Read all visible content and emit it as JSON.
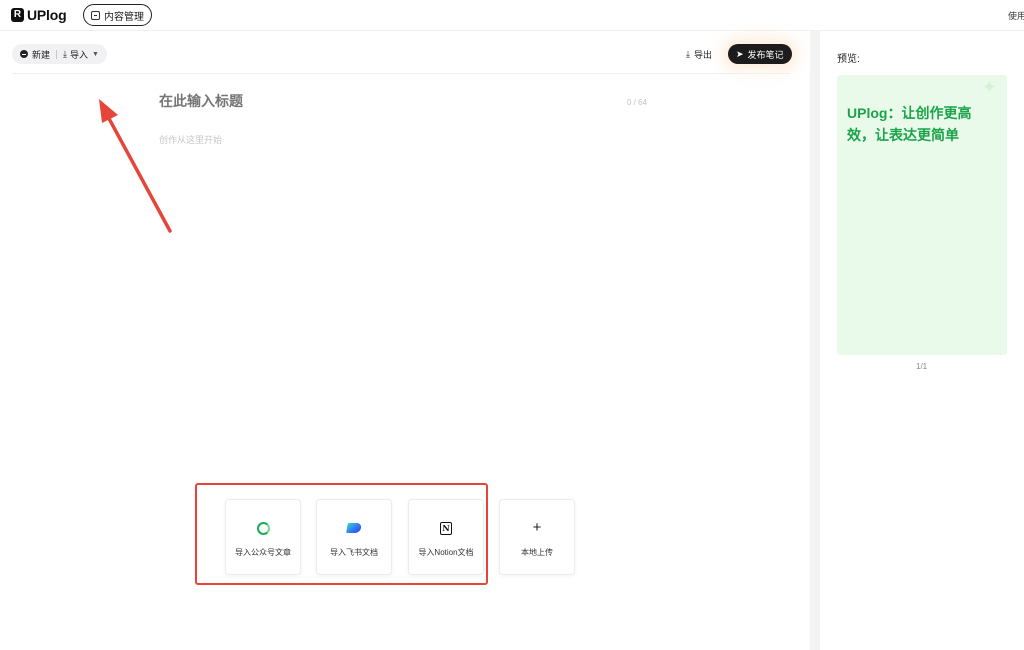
{
  "app": {
    "logo_mark": "R",
    "logo_text": "UPlog",
    "content_mgmt_label": "内容管理",
    "use_text": "使用"
  },
  "toolbar": {
    "new_label": "新建",
    "import_label": "导入",
    "export_label": "导出",
    "publish_label": "发布笔记"
  },
  "editor": {
    "title_placeholder": "在此输入标题",
    "title_count": "0 / 64",
    "body_placeholder": "创作从这里开始"
  },
  "import_options": [
    {
      "label": "导入公众号文章",
      "icon": "wechat-icon"
    },
    {
      "label": "导入飞书文档",
      "icon": "feishu-icon"
    },
    {
      "label": "导入Notion文档",
      "icon": "notion-icon"
    },
    {
      "label": "本地上传",
      "icon": "plus-icon"
    }
  ],
  "preview": {
    "label": "预览:",
    "card_text": "UPlog：让创作更高效，让表达更简单",
    "page_indicator": "1/1"
  },
  "colors": {
    "accent_green": "#1aa34a",
    "preview_bg": "#eafaea",
    "annotation_red": "#e6453a",
    "dark_button": "#1c1c1c"
  }
}
